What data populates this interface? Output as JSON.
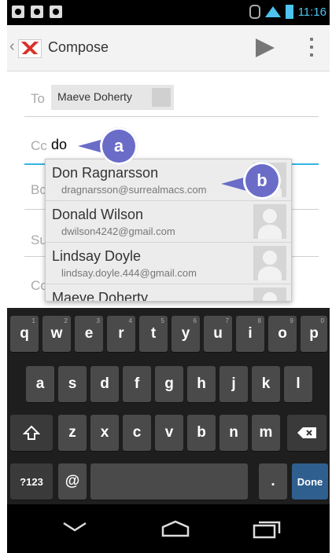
{
  "status_bar": {
    "time": "11:16"
  },
  "action_bar": {
    "title": "Compose"
  },
  "fields": {
    "to_label": "To",
    "to_chip": "Maeve Doherty",
    "cc_label": "Cc",
    "cc_value": "do",
    "bcc_label_partial": "Bc",
    "subject_label_partial": "Su",
    "compose_label_partial": "Co"
  },
  "callouts": {
    "a": "a",
    "b": "b"
  },
  "suggestions": [
    {
      "name": "Don Ragnarsson",
      "email": "dragnarsson@surrealmacs.com"
    },
    {
      "name": "Donald Wilson",
      "email": "dwilson4242@gmail.com"
    },
    {
      "name": "Lindsay Doyle",
      "email": "lindsay.doyle.444@gmail.com"
    },
    {
      "name": "Maeve Doherty",
      "email": ""
    }
  ],
  "keyboard": {
    "row1": [
      "q",
      "w",
      "e",
      "r",
      "t",
      "y",
      "u",
      "i",
      "o",
      "p"
    ],
    "row1_hints": [
      "1",
      "2",
      "3",
      "4",
      "5",
      "6",
      "7",
      "8",
      "9",
      "0"
    ],
    "row2": [
      "a",
      "s",
      "d",
      "f",
      "g",
      "h",
      "j",
      "k",
      "l"
    ],
    "row3": [
      "z",
      "x",
      "c",
      "v",
      "b",
      "n",
      "m"
    ],
    "sym_key": "?123",
    "at_key": "@",
    "period_key": ".",
    "done_key": "Done"
  }
}
